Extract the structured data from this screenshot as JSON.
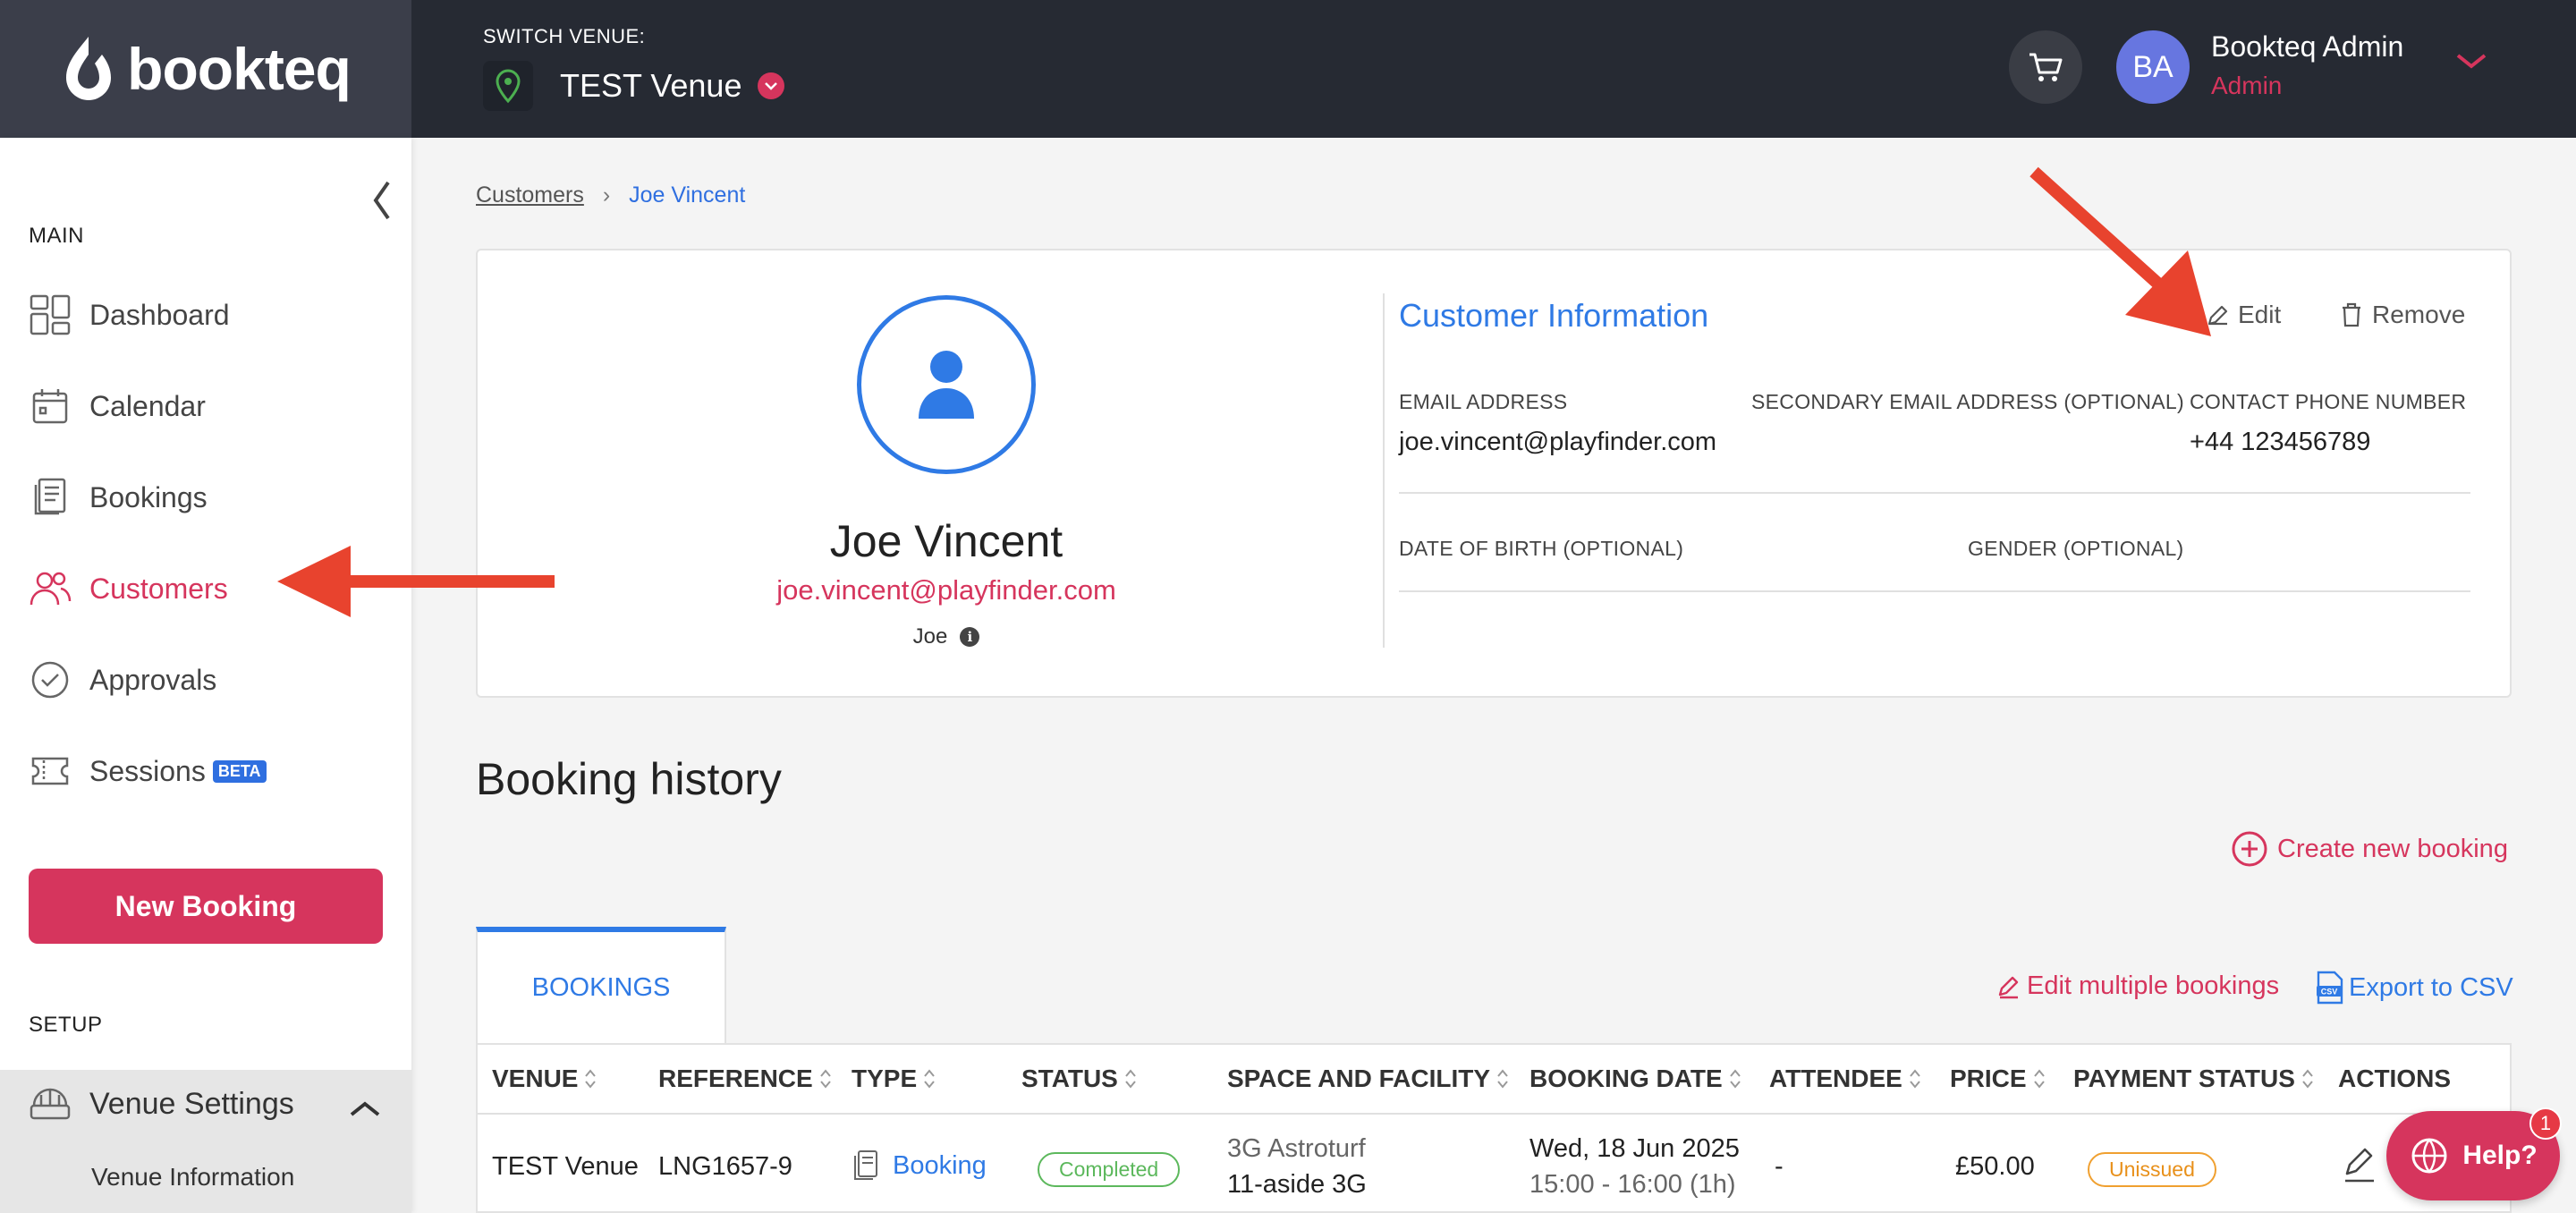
{
  "brand": {
    "name": "bookteq"
  },
  "header": {
    "switch_label": "SWITCH VENUE:",
    "venue_name": "TEST Venue",
    "user_initials": "BA",
    "user_name": "Bookteq Admin",
    "user_role": "Admin"
  },
  "sidebar": {
    "main_label": "MAIN",
    "items": [
      {
        "label": "Dashboard",
        "icon": "dashboard-icon"
      },
      {
        "label": "Calendar",
        "icon": "calendar-icon"
      },
      {
        "label": "Bookings",
        "icon": "bookings-icon"
      },
      {
        "label": "Customers",
        "icon": "customers-icon",
        "active": true
      },
      {
        "label": "Approvals",
        "icon": "approvals-icon"
      },
      {
        "label": "Sessions",
        "icon": "sessions-icon",
        "badge": "BETA"
      }
    ],
    "new_booking": "New Booking",
    "setup_label": "SETUP",
    "venue_settings": "Venue Settings",
    "venue_information": "Venue Information"
  },
  "breadcrumb": {
    "parent": "Customers",
    "current": "Joe Vincent"
  },
  "profile": {
    "name": "Joe Vincent",
    "email": "joe.vincent@playfinder.com",
    "nickname": "Joe"
  },
  "customer_info": {
    "title": "Customer Information",
    "edit": "Edit",
    "remove": "Remove",
    "email_label": "EMAIL ADDRESS",
    "email_value": "joe.vincent@playfinder.com",
    "secondary_email_label": "SECONDARY EMAIL ADDRESS (OPTIONAL)",
    "phone_label": "CONTACT PHONE NUMBER",
    "phone_value": "+44 123456789",
    "dob_label": "DATE OF BIRTH (OPTIONAL)",
    "gender_label": "GENDER (OPTIONAL)"
  },
  "booking_history": {
    "title": "Booking history",
    "create_new": "Create new booking",
    "tab": "BOOKINGS",
    "edit_multiple": "Edit multiple bookings",
    "export_csv": "Export to CSV",
    "columns": [
      "VENUE",
      "REFERENCE",
      "TYPE",
      "STATUS",
      "SPACE AND FACILITY",
      "BOOKING DATE",
      "ATTENDEE",
      "PRICE",
      "PAYMENT STATUS",
      "ACTIONS"
    ],
    "rows": [
      {
        "venue": "TEST Venue",
        "reference": "LNG1657-9",
        "type": "Booking",
        "status": "Completed",
        "space": "3G Astroturf",
        "facility": "11-aside 3G",
        "date": "Wed, 18 Jun 2025",
        "time": "15:00 - 16:00 (1h)",
        "attendee": "-",
        "price": "£50.00",
        "payment_status": "Unissued"
      }
    ]
  },
  "help": {
    "label": "Help?",
    "badge": "1"
  },
  "colors": {
    "accent": "#d6355d",
    "link": "#2f7ae5",
    "annotation_arrow": "#e8432e"
  }
}
